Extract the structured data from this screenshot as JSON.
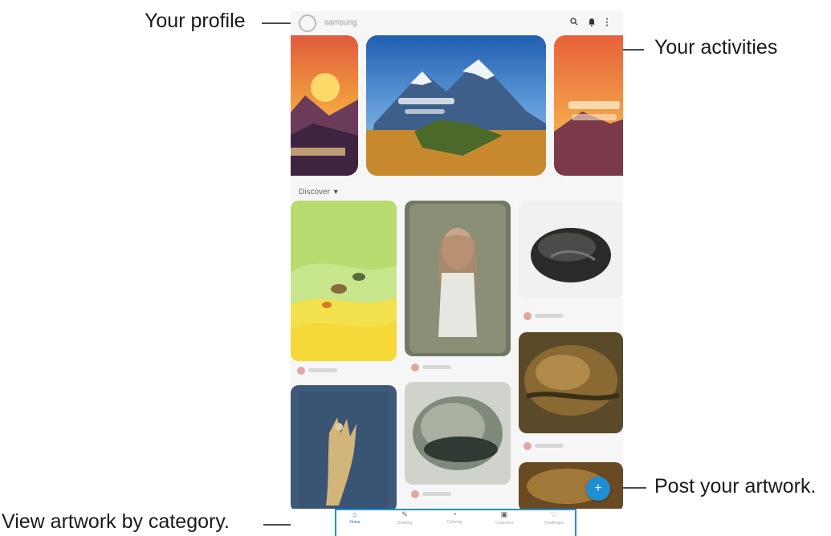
{
  "callouts": {
    "profile": "Your profile",
    "activities": "Your activities",
    "post": "Post your artwork.",
    "category": "View artwork by category."
  },
  "header": {
    "username": "samsung",
    "icons": [
      "search-icon",
      "bell-icon",
      "more-icon"
    ]
  },
  "feed": {
    "section_label": "Discover",
    "section_chevron": "▾"
  },
  "fab": {
    "label": "+"
  },
  "bottom_nav": [
    {
      "icon": "home-icon",
      "glyph": "⌂",
      "label": "Home"
    },
    {
      "icon": "brush-icon",
      "glyph": "✎",
      "label": "Drawing"
    },
    {
      "icon": "palette-icon",
      "glyph": "◔",
      "label": "Coloring"
    },
    {
      "icon": "gallery-icon",
      "glyph": "▣",
      "label": "Collection"
    },
    {
      "icon": "trophy-icon",
      "glyph": "♡",
      "label": "Challenges"
    }
  ],
  "colors": {
    "accent": "#1f8fd4",
    "callout_line": "#4a4a4a"
  }
}
